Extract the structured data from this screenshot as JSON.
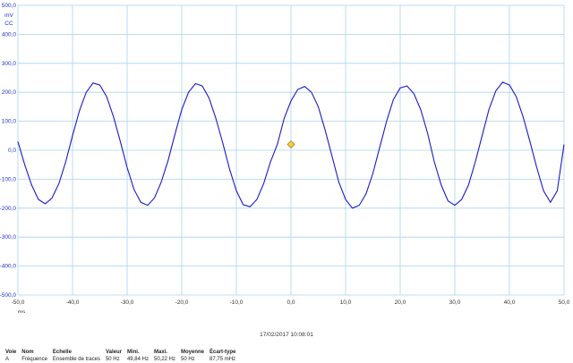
{
  "chart_data": {
    "type": "line",
    "title": "",
    "xlabel": "ms",
    "ylabel": "mV",
    "y_unit_lines": [
      "mV",
      "CC"
    ],
    "xlim": [
      -50,
      50
    ],
    "ylim": [
      -500,
      500
    ],
    "x_ticks": [
      -50,
      -40,
      -30,
      -20,
      -10,
      0,
      10,
      20,
      30,
      40,
      50
    ],
    "x_tick_labels": [
      "-50,0",
      "-40,0",
      "-30,0",
      "-20,0",
      "-10,0",
      "0,0",
      "10,0",
      "20,0",
      "30,0",
      "40,0",
      "50,0"
    ],
    "y_ticks": [
      500,
      400,
      300,
      200,
      100,
      0,
      -100,
      -200,
      -300,
      -400,
      -500
    ],
    "y_tick_labels": [
      "500,0",
      "400,0",
      "300,0",
      "200,0",
      "100,0",
      "0,0",
      "-100,0",
      "-200,0",
      "-300,0",
      "-400,0",
      "-500,0"
    ],
    "grid": true,
    "line_color": "#1a1acc",
    "grid_color": "#a8d4ec",
    "marker": {
      "x": 0,
      "y": 20,
      "color": "#f2d23c"
    },
    "series": [
      {
        "x": [
          -50,
          -48.75,
          -47.5,
          -46.25,
          -45,
          -43.75,
          -42.5,
          -41.25,
          -40,
          -38.75,
          -37.5,
          -36.25,
          -35,
          -33.75,
          -32.5,
          -31.25,
          -30,
          -28.75,
          -27.5,
          -26.25,
          -25,
          -23.75,
          -22.5,
          -21.25,
          -20,
          -18.75,
          -17.5,
          -16.25,
          -15,
          -13.75,
          -12.5,
          -11.25,
          -10,
          -8.75,
          -7.5,
          -6.25,
          -5,
          -3.75,
          -2.5,
          -1.25,
          0,
          1.25,
          2.5,
          3.75,
          5,
          6.25,
          7.5,
          8.75,
          10,
          11.25,
          12.5,
          13.75,
          15,
          16.25,
          17.5,
          18.75,
          20,
          21.25,
          22.5,
          23.75,
          25,
          26.25,
          27.5,
          28.75,
          30,
          31.25,
          32.5,
          33.75,
          35,
          36.25,
          37.5,
          38.75,
          40,
          41.25,
          42.5,
          43.75,
          45,
          46.25,
          47.5,
          48.75,
          50
        ],
        "y": [
          30,
          -50,
          -120,
          -170,
          -185,
          -165,
          -115,
          -40,
          50,
          135,
          200,
          232,
          225,
          185,
          115,
          30,
          -60,
          -135,
          -180,
          -190,
          -165,
          -110,
          -35,
          55,
          140,
          200,
          230,
          222,
          180,
          110,
          25,
          -65,
          -140,
          -188,
          -195,
          -170,
          -115,
          -40,
          20,
          110,
          170,
          210,
          220,
          200,
          150,
          70,
          -20,
          -110,
          -170,
          -200,
          -190,
          -150,
          -80,
          10,
          100,
          175,
          215,
          222,
          195,
          140,
          60,
          -40,
          -120,
          -175,
          -190,
          -170,
          -120,
          -40,
          50,
          140,
          205,
          235,
          225,
          185,
          115,
          30,
          -60,
          -140,
          -180,
          -140,
          20
        ]
      }
    ]
  },
  "timestamp": "17/02/2017 10:08:01",
  "channel_table": {
    "headers": [
      "Voie",
      "Nom",
      "Echelle",
      "Valeur",
      "Mini.",
      "Maxi.",
      "Moyenne",
      "Écart-type"
    ],
    "rows": [
      [
        "A",
        "Fréquence",
        "Ensemble de traces",
        "50 Hz",
        "49,84 Hz",
        "50,22 Hz",
        "50 Hz",
        "87,75 mHz"
      ]
    ]
  }
}
